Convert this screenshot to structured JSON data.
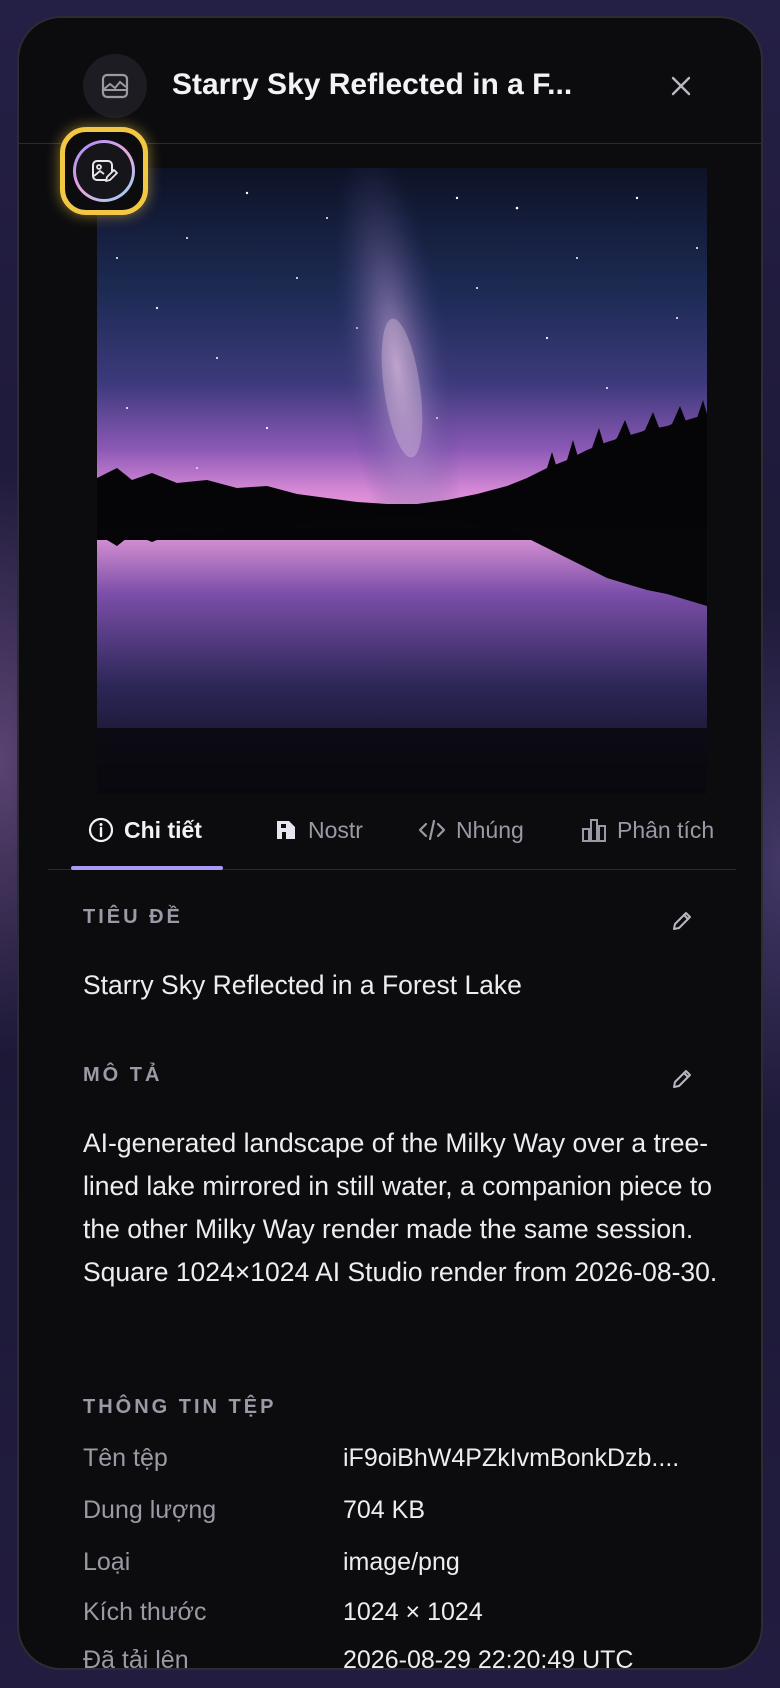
{
  "header": {
    "title": "Starry Sky Reflected in a F...",
    "image_icon": "image-icon",
    "close_icon": "close-icon",
    "edit_image_icon": "image-edit-icon"
  },
  "tabs": [
    {
      "label": "Chi tiết",
      "icon": "info-icon",
      "active": true
    },
    {
      "label": "Nostr",
      "icon": "nostr-icon",
      "active": false
    },
    {
      "label": "Nhúng",
      "icon": "code-icon",
      "active": false
    },
    {
      "label": "Phân tích",
      "icon": "bar-chart-icon",
      "active": false
    }
  ],
  "title_section": {
    "label": "TIÊU ĐỀ",
    "value": "Starry Sky Reflected in a Forest Lake"
  },
  "description_section": {
    "label": "MÔ TẢ",
    "value": "AI-generated landscape of the Milky Way over a tree-lined lake mirrored in still water, a companion piece to the other Milky Way render made the same session. Square 1024×1024 AI Studio render from 2026-08-30."
  },
  "file_info": {
    "label": "THÔNG TIN TỆP",
    "rows": [
      {
        "key": "Tên tệp",
        "value": "iF9oiBhW4PZkIvmBonkDzb...."
      },
      {
        "key": "Dung lượng",
        "value": "704 KB"
      },
      {
        "key": "Loại",
        "value": "image/png"
      },
      {
        "key": "Kích thước",
        "value": "1024 × 1024"
      },
      {
        "key": "Đã tải lên",
        "value": "2026-08-29 22:20:49 UTC"
      }
    ]
  },
  "colors": {
    "accent": "#a79cf5",
    "highlight": "#f1c743",
    "background": "#0c0c0f"
  }
}
